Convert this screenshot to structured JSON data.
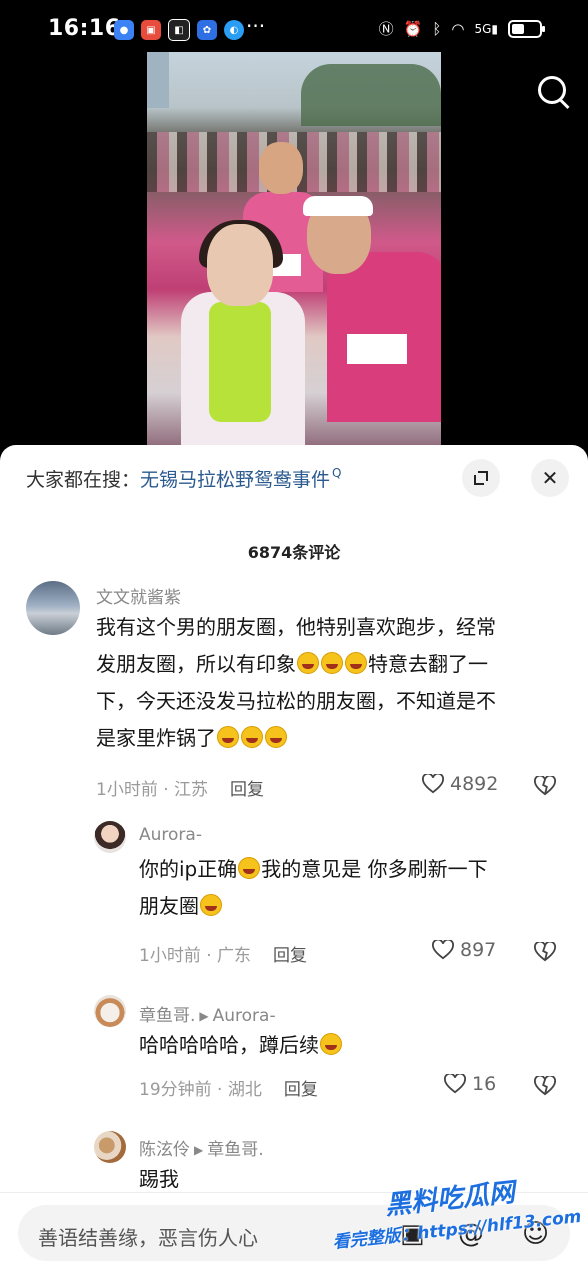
{
  "status_bar": {
    "time": "16:16",
    "network": "5G",
    "dots": "···"
  },
  "video": {},
  "trending": {
    "prefix": "大家都在搜：",
    "topic": "无锡马拉松野鸳鸯事件"
  },
  "comments_count": "6874条评论",
  "comments": [
    {
      "user": "文文就酱紫",
      "lines": [
        "我有这个男的朋友圈，他特别喜欢跑步，经常",
        "发朋友圈，所以有印象",
        "特意去翻了一",
        "下，今天还没发马拉松的朋友圈，不知道是不",
        "是家里炸锅了"
      ],
      "time": "1小时前 · 江苏",
      "reply": "回复",
      "likes": "4892"
    },
    {
      "user": "Aurora-",
      "lines": [
        "你的ip正确",
        "我的意见是 你多刷新一下",
        "朋友圈"
      ],
      "time": "1小时前 · 广东",
      "reply": "回复",
      "likes": "897"
    },
    {
      "user": "章鱼哥.",
      "reply_to": "Aurora-",
      "lines": [
        "哈哈哈哈哈，蹲后续"
      ],
      "time": "19分钟前 · 湖北",
      "reply": "回复",
      "likes": "16"
    },
    {
      "user": "陈泫伶",
      "reply_to": "章鱼哥.",
      "lines": [
        "踢我"
      ]
    }
  ],
  "input": {
    "placeholder": "善语结善缘，恶言伤人心"
  },
  "watermark": {
    "line1": "黑料吃瓜网",
    "line2": "看完整版：https://hlf13.com"
  },
  "colors": {
    "topic": "#2b5a8e",
    "accent_pink": "#d93d7c"
  }
}
